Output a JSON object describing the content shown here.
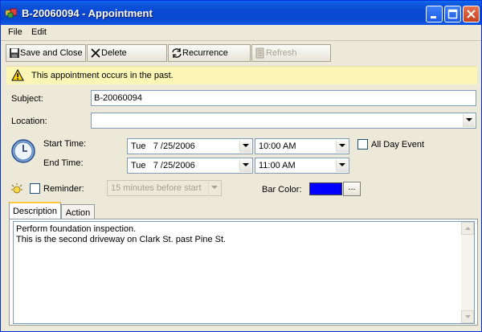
{
  "window": {
    "title": "B-20060094 - Appointment"
  },
  "menu": {
    "file": "File",
    "edit": "Edit"
  },
  "toolbar": {
    "save_close": "Save and Close",
    "delete": "Delete",
    "recurrence": "Recurrence",
    "refresh": "Refresh"
  },
  "banner": {
    "message": "This appointment occurs in the past."
  },
  "form": {
    "subject_label": "Subject:",
    "subject_value": "B-20060094",
    "location_label": "Location:",
    "location_value": "",
    "start_label": "Start Time:",
    "start_date": "Tue   7 /25/2006",
    "start_time": "10:00 AM",
    "end_label": "End Time:",
    "end_date": "Tue   7 /25/2006",
    "end_time": "11:00 AM",
    "all_day_label": "All Day Event",
    "all_day_checked": false,
    "reminder_label": "Reminder:",
    "reminder_checked": false,
    "reminder_value": "15 minutes before start",
    "bar_color_label": "Bar Color:",
    "bar_color": "#0000ff",
    "ellipsis": "..."
  },
  "tabs": [
    {
      "label": "Description",
      "active": true
    },
    {
      "label": "Action",
      "active": false
    }
  ],
  "description": {
    "lines": [
      "Perform foundation inspection.",
      "This is the second driveway on Clark St. past Pine St."
    ]
  }
}
